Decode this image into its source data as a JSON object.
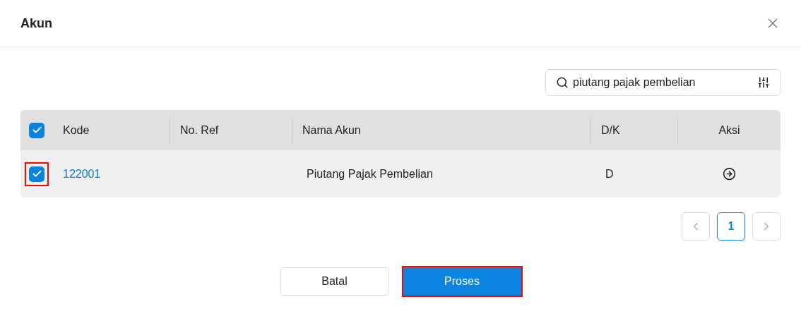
{
  "dialog": {
    "title": "Akun"
  },
  "search": {
    "value": "piutang pajak pembelian"
  },
  "table": {
    "select_all": {
      "checked": true
    },
    "columns": [
      "Kode",
      "No. Ref",
      "Nama Akun",
      "D/K",
      "Aksi"
    ],
    "rows": [
      {
        "checked": true,
        "highlighted": true,
        "kode": "122001",
        "no_ref": "",
        "nama_akun": "Piutang Pajak Pembelian",
        "dk": "D"
      }
    ]
  },
  "pagination": {
    "pages": [
      {
        "label": "1",
        "selected": true
      }
    ]
  },
  "buttons": [
    {
      "label": "Batal",
      "kind": "secondary",
      "highlighted": false
    },
    {
      "label": "Proses",
      "kind": "primary",
      "highlighted": true
    }
  ]
}
